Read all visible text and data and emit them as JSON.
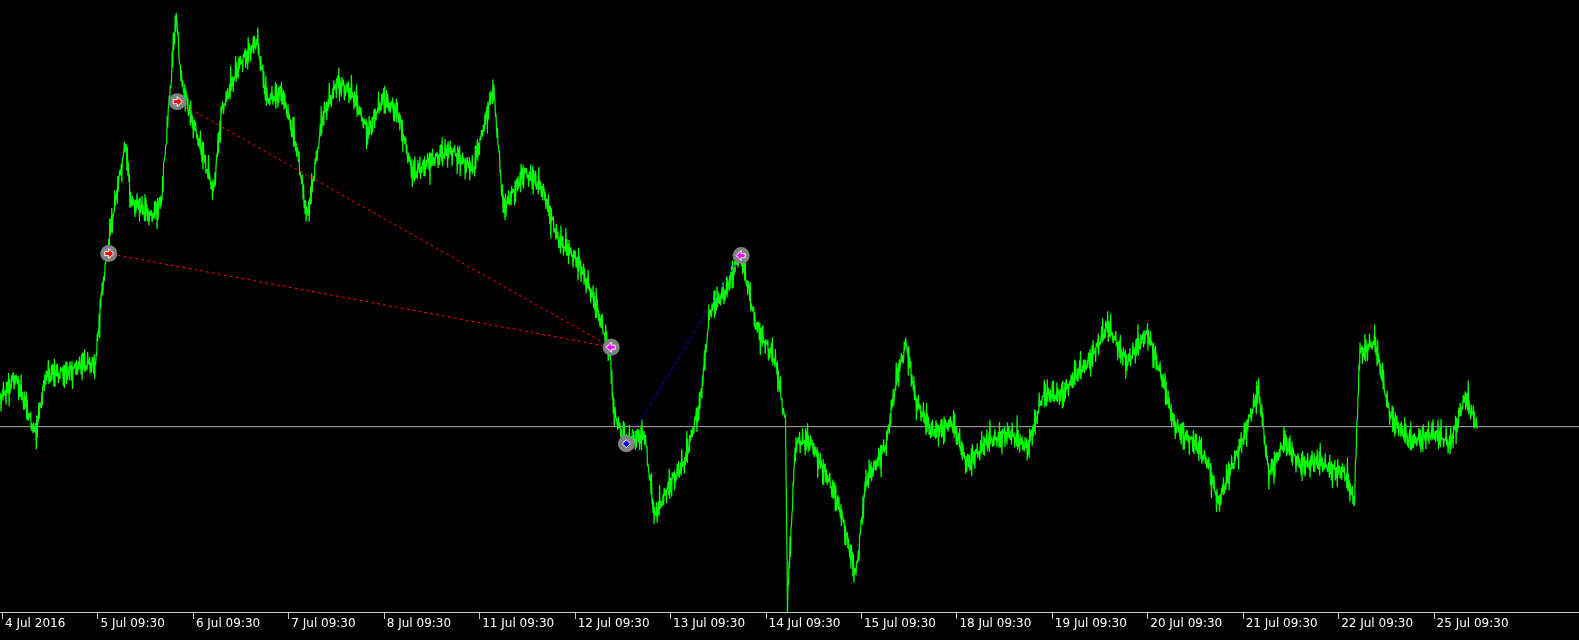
{
  "x_axis": {
    "labels": [
      "4 Jul 2016",
      "5 Jul 09:30",
      "6 Jul 09:30",
      "7 Jul 09:30",
      "8 Jul 09:30",
      "11 Jul 09:30",
      "12 Jul 09:30",
      "13 Jul 09:30",
      "14 Jul 09:30",
      "15 Jul 09:30",
      "18 Jul 09:30",
      "19 Jul 09:30",
      "20 Jul 09:30",
      "21 Jul 09:30",
      "22 Jul 09:30",
      "25 Jul 09:30"
    ]
  }
}
